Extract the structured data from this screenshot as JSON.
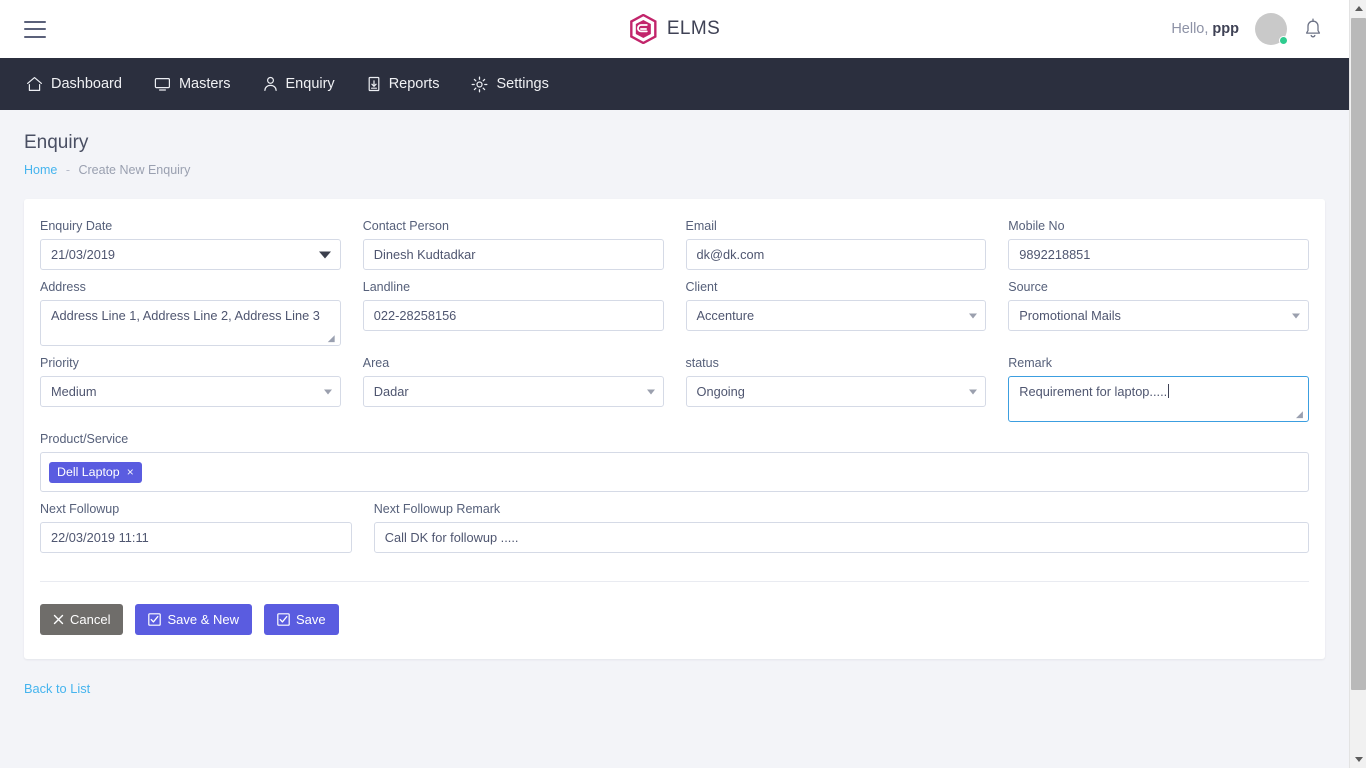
{
  "topbar": {
    "menu_icon": "hamburger-icon",
    "brand": "ELMS",
    "greeting_prefix": "Hello,",
    "user_name": "ppp",
    "bell_icon": "bell-icon",
    "brand_color": "#c2256b"
  },
  "nav": {
    "items": [
      {
        "label": "Dashboard",
        "icon": "home-icon"
      },
      {
        "label": "Masters",
        "icon": "monitor-icon"
      },
      {
        "label": "Enquiry",
        "icon": "user-icon"
      },
      {
        "label": "Reports",
        "icon": "report-download-icon"
      },
      {
        "label": "Settings",
        "icon": "gear-icon"
      }
    ]
  },
  "page": {
    "title": "Enquiry",
    "breadcrumb_home": "Home",
    "breadcrumb_sep": "-",
    "breadcrumb_current": "Create New Enquiry"
  },
  "form": {
    "enquiry_date": {
      "label": "Enquiry Date",
      "value": "21/03/2019"
    },
    "contact_person": {
      "label": "Contact Person",
      "value": "Dinesh Kudtadkar"
    },
    "email": {
      "label": "Email",
      "value": "dk@dk.com"
    },
    "mobile_no": {
      "label": "Mobile No",
      "value": "9892218851"
    },
    "address": {
      "label": "Address",
      "value": "Address Line 1, Address Line 2, Address Line 3"
    },
    "landline": {
      "label": "Landline",
      "value": "022-28258156"
    },
    "client": {
      "label": "Client",
      "value": "Accenture"
    },
    "source": {
      "label": "Source",
      "value": "Promotional Mails"
    },
    "priority": {
      "label": "Priority",
      "value": "Medium"
    },
    "area": {
      "label": "Area",
      "value": "Dadar"
    },
    "status": {
      "label": "status",
      "value": "Ongoing"
    },
    "remark": {
      "label": "Remark",
      "value": "Requirement for laptop.....",
      "focused": true
    },
    "product_service": {
      "label": "Product/Service",
      "tags": [
        {
          "label": "Dell Laptop",
          "remove": "×"
        }
      ]
    },
    "next_followup": {
      "label": "Next Followup",
      "value": "22/03/2019 11:11"
    },
    "next_followup_remark": {
      "label": "Next Followup Remark",
      "value": "Call DK for followup ....."
    }
  },
  "buttons": {
    "cancel": "Cancel",
    "save_new": "Save & New",
    "save": "Save",
    "cancel_color": "#6f6d6a",
    "save_color": "#5a5ce0"
  },
  "footer": {
    "back_to_list": "Back to List"
  }
}
